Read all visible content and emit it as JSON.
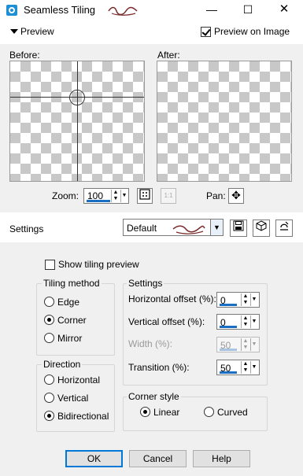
{
  "window": {
    "title": "Seamless Tiling",
    "minimize": "—",
    "maximize": "☐",
    "close": "✕"
  },
  "preview": {
    "toggle_label": "Preview",
    "preview_on_image_label": "Preview on Image",
    "preview_on_image_checked": true,
    "before_label": "Before:",
    "after_label": "After:",
    "zoom_label": "Zoom:",
    "zoom_value": "100",
    "pan_label": "Pan:"
  },
  "settings": {
    "label": "Settings",
    "preset_value": "Default",
    "show_tiling_preview_label": "Show tiling preview",
    "show_tiling_preview_checked": false
  },
  "tiling_method": {
    "title": "Tiling method",
    "options": [
      "Edge",
      "Corner",
      "Mirror"
    ],
    "selected": "Corner"
  },
  "direction": {
    "title": "Direction",
    "options": [
      "Horizontal",
      "Vertical",
      "Bidirectional"
    ],
    "selected": "Bidirectional"
  },
  "settings_group": {
    "title": "Settings",
    "horizontal_offset_label": "Horizontal offset (%):",
    "horizontal_offset_value": "0",
    "vertical_offset_label": "Vertical offset (%):",
    "vertical_offset_value": "0",
    "width_label": "Width (%):",
    "width_value": "50",
    "transition_label": "Transition (%):",
    "transition_value": "50"
  },
  "corner_style": {
    "title": "Corner style",
    "options": [
      "Linear",
      "Curved"
    ],
    "selected": "Linear"
  },
  "buttons": {
    "ok": "OK",
    "cancel": "Cancel",
    "help": "Help"
  },
  "colors": {
    "accent": "#0078d7",
    "panel_bg": "#f0f0f0",
    "checker": "#c8c8c8"
  }
}
